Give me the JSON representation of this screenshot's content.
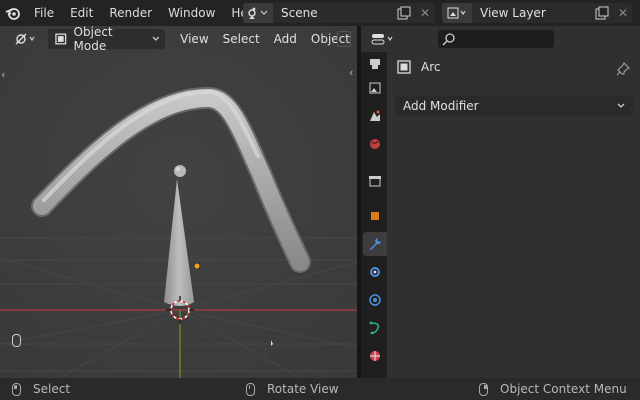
{
  "topbar": {
    "menus": [
      "File",
      "Edit",
      "Render",
      "Window",
      "Help"
    ],
    "scene_label": "Scene",
    "view_layer_label": "View Layer"
  },
  "viewport": {
    "mode_label": "Object Mode",
    "menus": [
      "View",
      "Select",
      "Add",
      "Object"
    ]
  },
  "properties": {
    "search_placeholder": "",
    "object_name": "Arc",
    "add_modifier_label": "Add Modifier",
    "tabs": [
      "tool-tab",
      "render-tab",
      "output-tab",
      "view-layer-tab",
      "scene-tab",
      "world-tab",
      "collection-tab",
      "object-tab",
      "modifier-tab",
      "particles-tab",
      "physics-tab",
      "constraints-tab",
      "data-tab"
    ],
    "active_tab": "modifier-tab"
  },
  "statusbar": {
    "select_label": "Select",
    "rotate_label": "Rotate View",
    "context_label": "Object Context Menu"
  },
  "colors": {
    "viewport_bg": "#3d3d3d",
    "panel_bg": "#303030",
    "axis_x": "#b03a3a",
    "axis_y": "#6a9a2a",
    "origin_dot": "#f0a020"
  }
}
